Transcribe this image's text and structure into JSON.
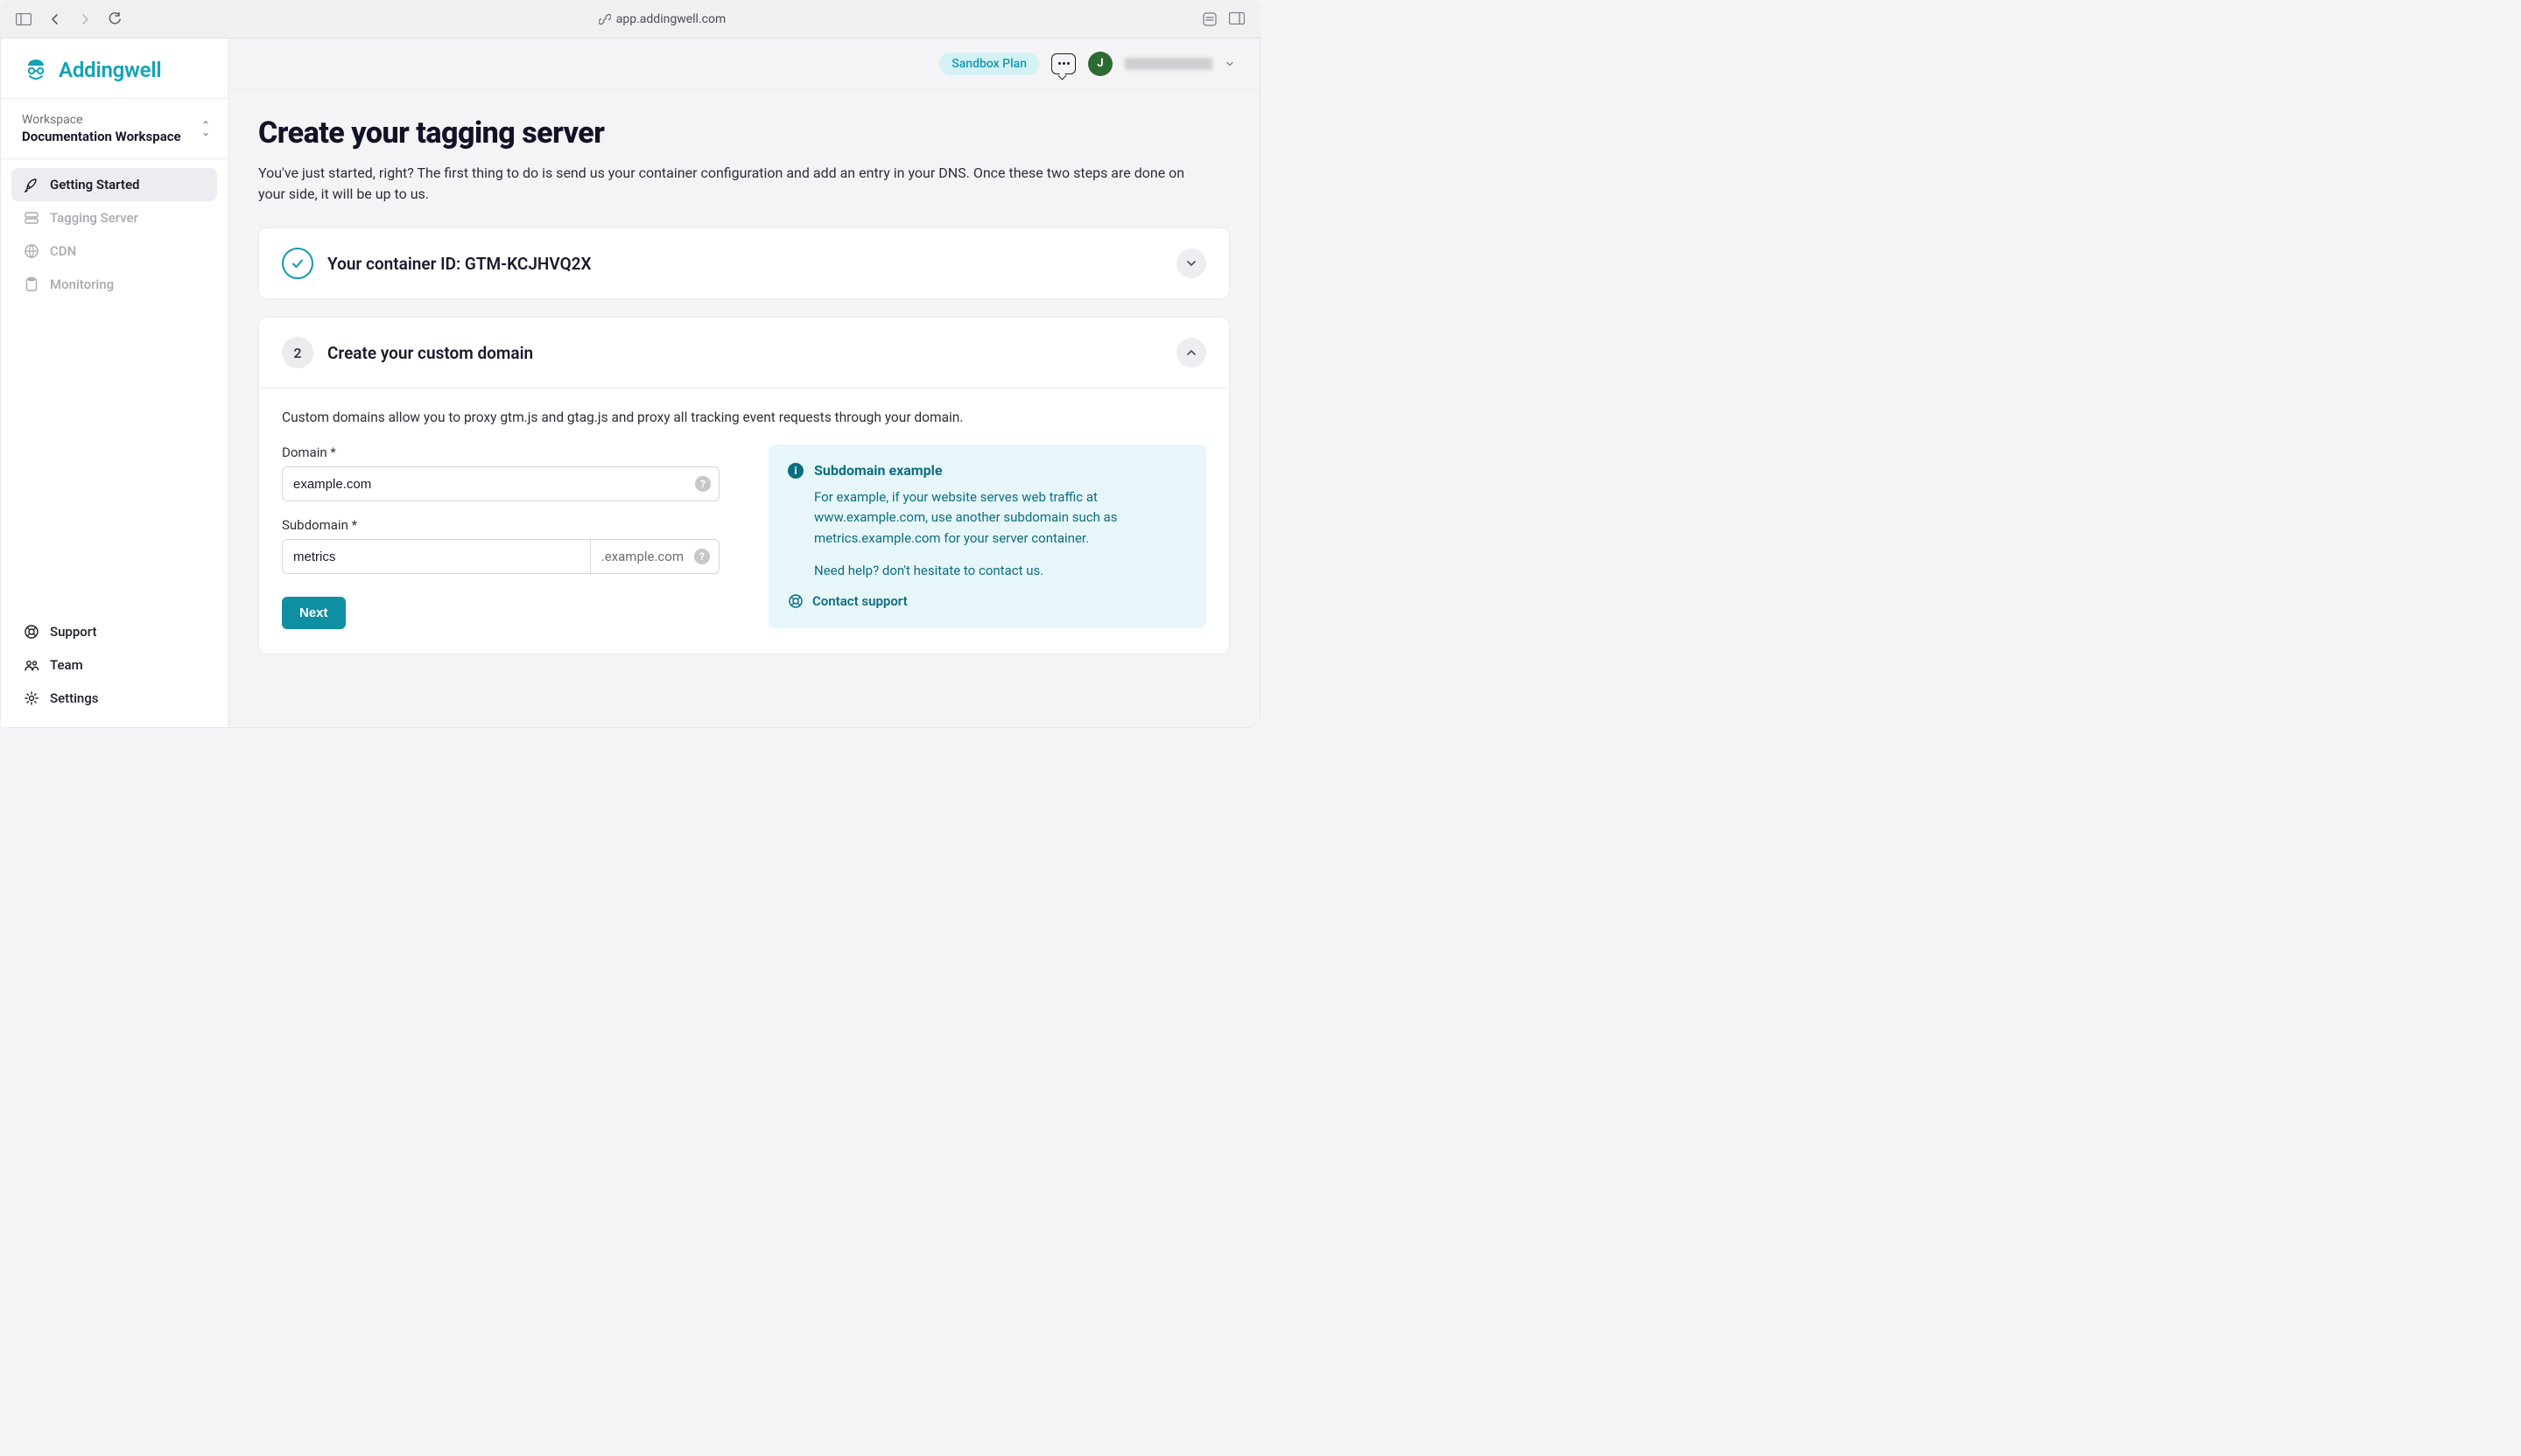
{
  "browser": {
    "url": "app.addingwell.com"
  },
  "brand": {
    "name": "Addingwell"
  },
  "workspace": {
    "label": "Workspace",
    "name": "Documentation Workspace"
  },
  "sidebar": {
    "items": [
      {
        "label": "Getting Started",
        "icon": "rocket-icon",
        "active": true
      },
      {
        "label": "Tagging Server",
        "icon": "server-icon",
        "active": false
      },
      {
        "label": "CDN",
        "icon": "globe-icon",
        "active": false
      },
      {
        "label": "Monitoring",
        "icon": "clipboard-icon",
        "active": false
      }
    ]
  },
  "bottom_nav": {
    "support": "Support",
    "team": "Team",
    "settings": "Settings"
  },
  "header": {
    "plan": "Sandbox Plan",
    "avatar_initial": "J"
  },
  "page": {
    "title": "Create your tagging server",
    "description": "You've just started, right? The first thing to do is send us your container configuration and add an entry in your DNS. Once these two steps are done on your side, it will be up to us."
  },
  "step1": {
    "title": "Your container ID: GTM-KCJHVQ2X"
  },
  "step2": {
    "number": "2",
    "title": "Create your custom domain",
    "description": "Custom domains allow you to proxy gtm.js and gtag.js and proxy all tracking event requests through your domain.",
    "domain_label": "Domain *",
    "domain_value": "example.com",
    "subdomain_label": "Subdomain *",
    "subdomain_value": "metrics",
    "subdomain_suffix": ".example.com",
    "next_label": "Next"
  },
  "info": {
    "title": "Subdomain example",
    "text1": "For example, if your website serves web traffic at www.example.com, use another subdomain such as metrics.example.com for your server container.",
    "text2": "Need help? don't hesitate to contact us.",
    "contact": "Contact support"
  }
}
